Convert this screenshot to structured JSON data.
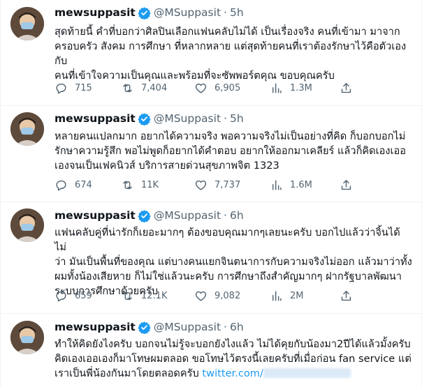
{
  "tweets": [
    {
      "name": "mewsuppasit",
      "handle": "@MSuppasit",
      "time": "5h",
      "text": "สุดท้ายนี้ คำที่บอกว่าศิลปินเลือกแฟนคลับไม่ได้ เป็นเรื่องจริง คนที่เข้ามา มาจาก\nครอบครัว สังคม การศึกษา ที่หลากหลาย แต่สุดท้ายคนที่เราต้องรักษาไว้คือตัวเองกับ\nคนที่เข้าใจความเป็นคุณและพร้อมที่จะซัพพอร์ตคุณ ขอบคุณครับ",
      "replies": "715",
      "retweets": "7,404",
      "likes": "6,905",
      "views": "1.3M"
    },
    {
      "name": "mewsuppasit",
      "handle": "@MSuppasit",
      "time": "5h",
      "text": "หลายคนแปลกมาก อยากได้ความจริง พอความจริงไม่เป็นอย่างที่คิด ก็บอกบอกไม่\nรักษาความรู้สึก พอไม่พูดก็อยากได้คำตอบ อยากให้ออกมาเคลียร์ แล้วก็คิดเองเออ\nเองจนเป็นเฟคนิวส์ บริการสายด่วนสุขภาพจิต 1323",
      "replies": "674",
      "retweets": "11K",
      "likes": "7,737",
      "views": "1.6M"
    },
    {
      "name": "mewsuppasit",
      "handle": "@MSuppasit",
      "time": "6h",
      "text": "แฟนคลับคู่ที่น่ารักก็เยอะมากๆ ต้องขอบคุณมากๆเลยนะครับ บอกไปแล้วว่าจิ้นได้ ไม่\nว่า มันเป็นพื้นที่ของคุณ แต่บางคนแยกจินตนาการกับความจริงไม่ออก แล้วมาว่าทั้ง\nผมทั้งน้องเสียหาย ก็ไม่ใช่แล้วนะครับ การศึกษาถึงสำคัญมากๆ ฝากรัฐบาลพัฒนา\nระบบการศึกษาด้วยครับ",
      "replies": "659",
      "retweets": "12.1K",
      "likes": "9,082",
      "views": "2M"
    },
    {
      "name": "mewsuppasit",
      "handle": "@MSuppasit",
      "time": "6h",
      "text": "ทำให้คิดยังไงครับ บอกจนไม่รู้จะบอกยังไงแล้ว ไม่ได้คุยกับน้องมา2ปีได้แล้วมั้งครับ\nคิดเองเออเองก็มาโทษผมตลอด ขอโทษไว้ตรงนี้เลยครับที่เมื่อก่อน fan service แต่\nเราเป็นพี่น้องกันมาโดยตลอดครับ ",
      "link": "twitter.com/"
    }
  ]
}
